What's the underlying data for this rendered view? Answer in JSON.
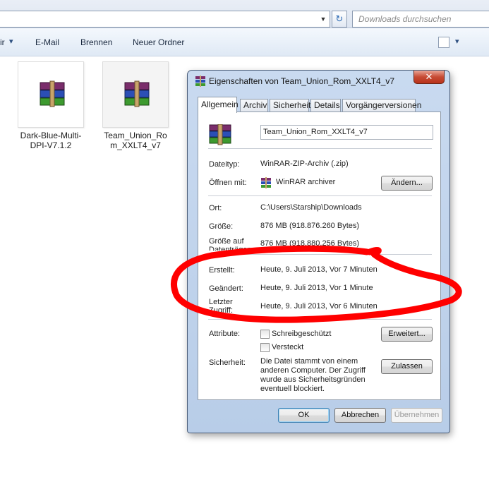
{
  "search": {
    "placeholder": "Downloads durchsuchen"
  },
  "toolbar": {
    "partial_left": "ir",
    "email": "E-Mail",
    "burn": "Brennen",
    "new_folder": "Neuer Ordner"
  },
  "files": [
    {
      "name_line1": "Dark-Blue-Multi-",
      "name_line2": "DPI-V7.1.2"
    },
    {
      "name_line1": "Team_Union_Ro",
      "name_line2": "m_XXLT4_v7"
    }
  ],
  "dialog": {
    "title": "Eigenschaften von Team_Union_Rom_XXLT4_v7",
    "close": "✕",
    "tabs": [
      "Allgemein",
      "Archiv",
      "Sicherheit",
      "Details",
      "Vorgängerversionen"
    ],
    "filename": "Team_Union_Rom_XXLT4_v7",
    "filetype_label": "Dateityp:",
    "filetype_value": "WinRAR-ZIP-Archiv (.zip)",
    "opens_with_label": "Öffnen mit:",
    "opens_with_value": "WinRAR archiver",
    "change_button": "Ändern...",
    "location_label": "Ort:",
    "location_value": "C:\\Users\\Starship\\Downloads",
    "size_label": "Größe:",
    "size_value": "876 MB (918.876.260 Bytes)",
    "disk_size_label1": "Größe auf",
    "disk_size_label2": "Datenträger:",
    "disk_size_value": "876 MB (918.880.256 Bytes)",
    "created_label": "Erstellt:",
    "created_value": "Heute, 9. Juli 2013, Vor 7 Minuten",
    "modified_label": "Geändert:",
    "modified_value": "Heute, 9. Juli 2013, Vor 1 Minute",
    "accessed_label1": "Letzter",
    "accessed_label2": "Zugriff:",
    "accessed_value": "Heute, 9. Juli 2013, Vor 6 Minuten",
    "attributes_label": "Attribute:",
    "readonly_label": "Schreibgeschützt",
    "hidden_label": "Versteckt",
    "advanced_button": "Erweitert...",
    "security_label": "Sicherheit:",
    "security_text": "Die Datei stammt von einem anderen Computer. Der Zugriff wurde aus Sicherheitsgründen eventuell blockiert.",
    "unblock_button": "Zulassen",
    "ok_button": "OK",
    "cancel_button": "Abbrechen",
    "apply_button": "Übernehmen",
    "readonly_checked": false,
    "hidden_checked": false
  },
  "colors": {
    "annotation_red": "#ff0000",
    "dialog_frame": "#b8cde8"
  }
}
